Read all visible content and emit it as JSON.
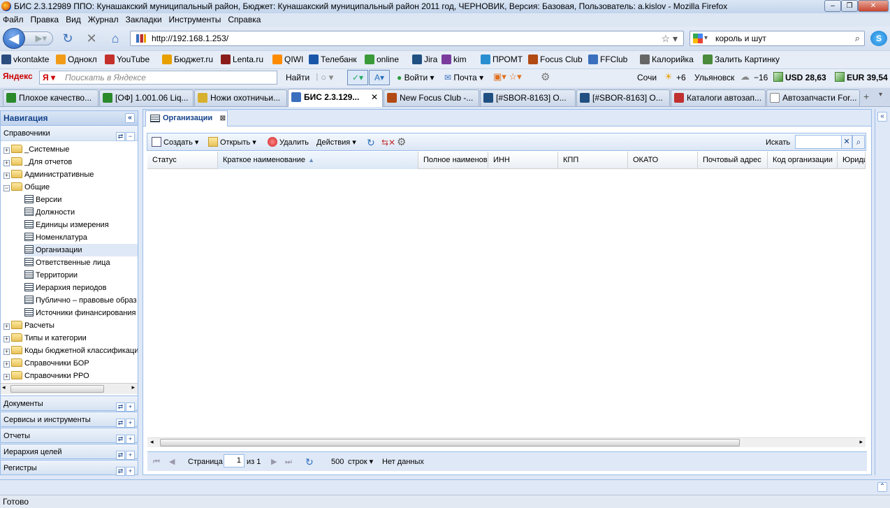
{
  "window": {
    "title": "БИС 2.3.12989 ППО: Кунашакский муниципальный район, Бюджет: Кунашакский муниципальный район 2011 год, ЧЕРНОВИК, Версия: Базовая, Пользователь: a.kislov - Mozilla Firefox"
  },
  "menu": [
    "Файл",
    "Правка",
    "Вид",
    "Журнал",
    "Закладки",
    "Инструменты",
    "Справка"
  ],
  "nav": {
    "url": "http://192.168.1.253/",
    "search": "король и шут"
  },
  "bookmarks": [
    {
      "label": "vkontakte",
      "color": "#2b4c7e"
    },
    {
      "label": "Однокл",
      "color": "#f29b17"
    },
    {
      "label": "YouTube",
      "color": "#c4302b"
    },
    {
      "label": "Бюджет.ru",
      "color": "#e8a000"
    },
    {
      "label": "Lenta.ru",
      "color": "#8a1c1c"
    },
    {
      "label": "QIWI",
      "color": "#ff8c00"
    },
    {
      "label": "Телебанк",
      "color": "#1a56a8"
    },
    {
      "label": "online",
      "color": "#3a9a3a"
    },
    {
      "label": "Jira",
      "color": "#205081"
    },
    {
      "label": "kim",
      "color": "#7a3b9c"
    },
    {
      "label": "ПРОМТ",
      "color": "#2a8fd0"
    },
    {
      "label": "Focus Club",
      "color": "#b24a14"
    },
    {
      "label": "FFClub",
      "color": "#3a6fbd"
    },
    {
      "label": "Калорийка",
      "color": "#666666"
    },
    {
      "label": "Залить Картинку",
      "color": "#4a8a3a"
    }
  ],
  "yandex": {
    "logo": "Яндекс",
    "placeholder": "Поискать в Яндексе",
    "find": "Найти",
    "login": "Войти",
    "mail": "Почта",
    "city1": "Сочи",
    "temp1": "+6",
    "city2": "Ульяновск",
    "temp2": "−16",
    "usd": "USD 28,63",
    "eur": "EUR 39,54"
  },
  "tabs": [
    {
      "label": "Плохое качество...",
      "color": "#2a8a2a"
    },
    {
      "label": "[ОФ] 1.001.06 Liq...",
      "color": "#2a8a2a"
    },
    {
      "label": "Ножи охотничьи...",
      "color": "#d8b030"
    },
    {
      "label": "БИС 2.3.129...",
      "color": "#3a6fbd",
      "active": true
    },
    {
      "label": "New Focus Club -...",
      "color": "#b24a14"
    },
    {
      "label": "[#SBOR-8163] О...",
      "color": "#205081"
    },
    {
      "label": "[#SBOR-8163] О...",
      "color": "#205081"
    },
    {
      "label": "Каталоги автозап...",
      "color": "#c03030"
    },
    {
      "label": "Автозапчасти For...",
      "color": "#ffffff"
    }
  ],
  "sidebar": {
    "title": "Навигация",
    "section": "Справочники",
    "tree": [
      {
        "label": "_Системные",
        "type": "folder",
        "level": 0
      },
      {
        "label": "_Для отчетов",
        "type": "folder",
        "level": 0
      },
      {
        "label": "Административные",
        "type": "folder",
        "level": 0
      },
      {
        "label": "Общие",
        "type": "folder-open",
        "level": 0
      },
      {
        "label": "Версии",
        "type": "leaf",
        "level": 1
      },
      {
        "label": "Должности",
        "type": "leaf",
        "level": 1
      },
      {
        "label": "Единицы измерения",
        "type": "leaf",
        "level": 1
      },
      {
        "label": "Номенклатура",
        "type": "leaf",
        "level": 1
      },
      {
        "label": "Организации",
        "type": "leaf",
        "level": 1,
        "selected": true
      },
      {
        "label": "Ответственные лица",
        "type": "leaf",
        "level": 1
      },
      {
        "label": "Территории",
        "type": "leaf",
        "level": 1
      },
      {
        "label": "Иерархия периодов",
        "type": "leaf",
        "level": 1
      },
      {
        "label": "Публично – правовые образ",
        "type": "leaf",
        "level": 1
      },
      {
        "label": "Источники финансирования",
        "type": "leaf",
        "level": 1
      },
      {
        "label": "Расчеты",
        "type": "folder",
        "level": 0
      },
      {
        "label": "Типы и категории",
        "type": "folder",
        "level": 0
      },
      {
        "label": "Коды бюджетной классификаци",
        "type": "folder",
        "level": 0
      },
      {
        "label": "Справочники БОР",
        "type": "folder",
        "level": 0
      },
      {
        "label": "Справочники РРО",
        "type": "folder",
        "level": 0
      }
    ],
    "sections": [
      "Документы",
      "Сервисы и инструменты",
      "Отчеты",
      "Иерархия целей",
      "Регистры"
    ]
  },
  "content": {
    "tab": "Организации",
    "toolbar": {
      "create": "Создать",
      "open": "Открыть",
      "delete": "Удалить",
      "actions": "Действия",
      "search_label": "Искать"
    },
    "columns": [
      "Статус",
      "Краткое наименование",
      "Полное наименова",
      "ИНН",
      "КПП",
      "ОКАТО",
      "Почтовый адрес",
      "Код организации",
      "Юриди"
    ],
    "pager": {
      "page_label": "Страница",
      "page": "1",
      "of": "из 1",
      "rows": "500",
      "rows_label": "строк",
      "nodata": "Нет данных"
    }
  },
  "status": "Готово"
}
